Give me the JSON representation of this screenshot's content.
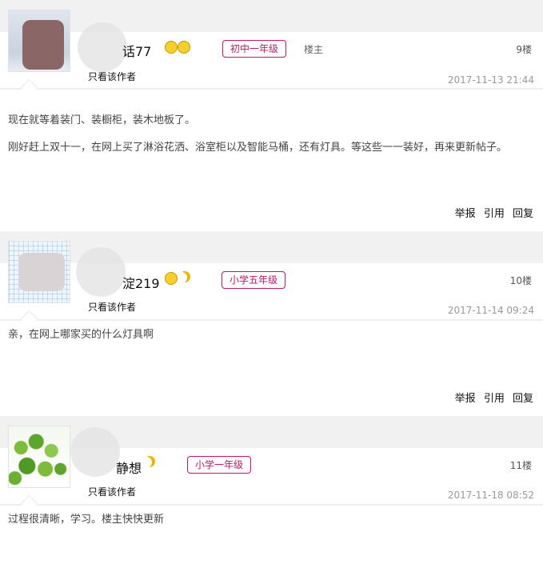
{
  "posts": [
    {
      "username": "话77",
      "grade": "初中一年级",
      "louzhu": "楼主",
      "floor": "9楼",
      "only_author": "只看该作者",
      "timestamp": "2017-11-13 21:44",
      "paragraphs": [
        "现在就等着装门、装橱柜，装木地板了。",
        "刚好赶上双十一，在网上买了淋浴花洒、浴室柜以及智能马桶，还有灯具。等这些一一装好，再来更新帖子。"
      ],
      "actions": {
        "report": "举报",
        "quote": "引用",
        "reply": "回复"
      }
    },
    {
      "username": "淀219",
      "grade": "小学五年级",
      "floor": "10楼",
      "only_author": "只看该作者",
      "timestamp": "2017-11-14 09:24",
      "paragraphs": [
        "亲，在网上哪家买的什么灯具啊"
      ],
      "actions": {
        "report": "举报",
        "quote": "引用",
        "reply": "回复"
      }
    },
    {
      "username": "静想",
      "grade": "小学一年级",
      "floor": "11楼",
      "only_author": "只看该作者",
      "timestamp": "2017-11-18 08:52",
      "paragraphs": [
        "过程很清晰，学习。楼主快快更新"
      ]
    }
  ],
  "colors": {
    "grade_badge": "#c2186b",
    "band": "#f1f1f1"
  },
  "icons": [
    "smiley-icon",
    "moon-icon"
  ]
}
